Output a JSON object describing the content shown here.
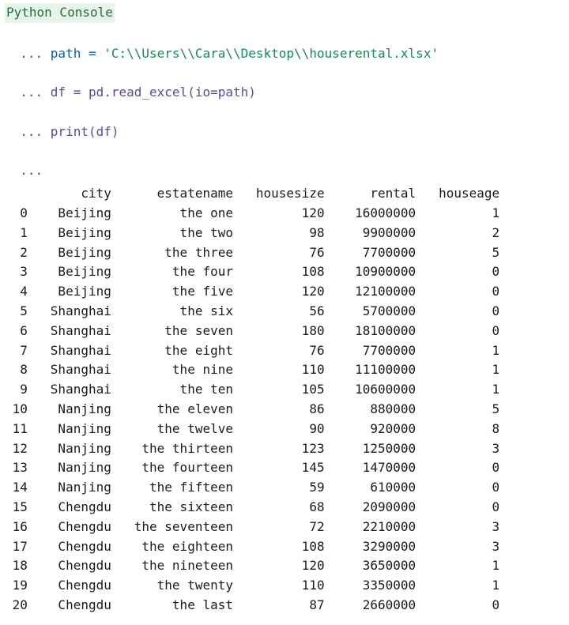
{
  "title": "Python Console",
  "prompt": "... ",
  "code": {
    "line1_pre": "path = ",
    "line1_str": "'C:\\\\Users\\\\Cara\\\\Desktop\\\\houserental.xlsx'",
    "line2": "df = pd.read_excel(io=path)",
    "line3": "print(df)",
    "line4": ""
  },
  "df": {
    "columns": [
      "city",
      "estatename",
      "housesize",
      "rental",
      "houseage"
    ],
    "rows": [
      {
        "i": 0,
        "city": "Beijing",
        "estatename": "the one",
        "housesize": 120,
        "rental": 16000000,
        "houseage": 1
      },
      {
        "i": 1,
        "city": "Beijing",
        "estatename": "the two",
        "housesize": 98,
        "rental": 9900000,
        "houseage": 2
      },
      {
        "i": 2,
        "city": "Beijing",
        "estatename": "the three",
        "housesize": 76,
        "rental": 7700000,
        "houseage": 5
      },
      {
        "i": 3,
        "city": "Beijing",
        "estatename": "the four",
        "housesize": 108,
        "rental": 10900000,
        "houseage": 0
      },
      {
        "i": 4,
        "city": "Beijing",
        "estatename": "the five",
        "housesize": 120,
        "rental": 12100000,
        "houseage": 0
      },
      {
        "i": 5,
        "city": "Shanghai",
        "estatename": "the six",
        "housesize": 56,
        "rental": 5700000,
        "houseage": 0
      },
      {
        "i": 6,
        "city": "Shanghai",
        "estatename": "the seven",
        "housesize": 180,
        "rental": 18100000,
        "houseage": 0
      },
      {
        "i": 7,
        "city": "Shanghai",
        "estatename": "the eight",
        "housesize": 76,
        "rental": 7700000,
        "houseage": 1
      },
      {
        "i": 8,
        "city": "Shanghai",
        "estatename": "the nine",
        "housesize": 110,
        "rental": 11100000,
        "houseage": 1
      },
      {
        "i": 9,
        "city": "Shanghai",
        "estatename": "the ten",
        "housesize": 105,
        "rental": 10600000,
        "houseage": 1
      },
      {
        "i": 10,
        "city": "Nanjing",
        "estatename": "the eleven",
        "housesize": 86,
        "rental": 880000,
        "houseage": 5
      },
      {
        "i": 11,
        "city": "Nanjing",
        "estatename": "the twelve",
        "housesize": 90,
        "rental": 920000,
        "houseage": 8
      },
      {
        "i": 12,
        "city": "Nanjing",
        "estatename": "the thirteen",
        "housesize": 123,
        "rental": 1250000,
        "houseage": 3
      },
      {
        "i": 13,
        "city": "Nanjing",
        "estatename": "the fourteen",
        "housesize": 145,
        "rental": 1470000,
        "houseage": 0
      },
      {
        "i": 14,
        "city": "Nanjing",
        "estatename": "the fifteen",
        "housesize": 59,
        "rental": 610000,
        "houseage": 0
      },
      {
        "i": 15,
        "city": "Chengdu",
        "estatename": "the sixteen",
        "housesize": 68,
        "rental": 2090000,
        "houseage": 0
      },
      {
        "i": 16,
        "city": "Chengdu",
        "estatename": "the seventeen",
        "housesize": 72,
        "rental": 2210000,
        "houseage": 3
      },
      {
        "i": 17,
        "city": "Chengdu",
        "estatename": "the eighteen",
        "housesize": 108,
        "rental": 3290000,
        "houseage": 3
      },
      {
        "i": 18,
        "city": "Chengdu",
        "estatename": "the nineteen",
        "housesize": 120,
        "rental": 3650000,
        "houseage": 1
      },
      {
        "i": 19,
        "city": "Chengdu",
        "estatename": "the twenty",
        "housesize": 110,
        "rental": 3350000,
        "houseage": 1
      },
      {
        "i": 20,
        "city": "Chengdu",
        "estatename": "the last",
        "housesize": 87,
        "rental": 2660000,
        "houseage": 0
      }
    ]
  },
  "widths": {
    "idx": 3,
    "city": 9,
    "estatename": 14,
    "housesize": 10,
    "rental": 10,
    "houseage": 9
  }
}
